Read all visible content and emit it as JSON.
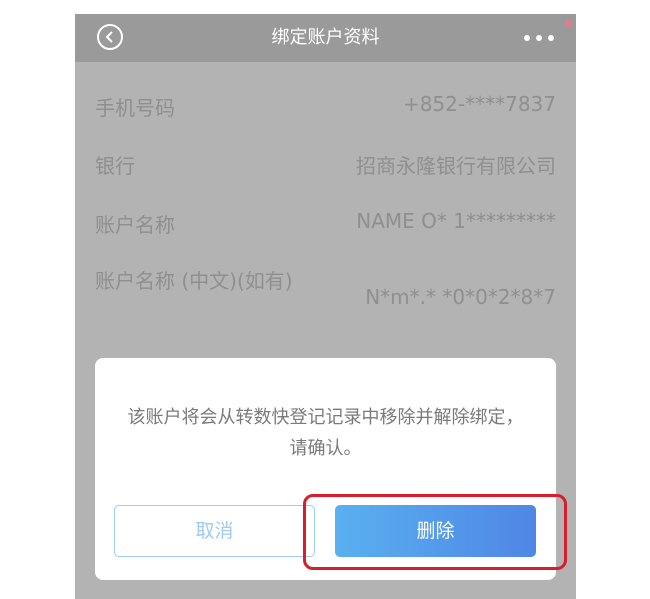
{
  "navbar": {
    "title": "绑定账户资料",
    "back_icon": "chevron-left-circle-icon",
    "more_icon": "more-dots-icon"
  },
  "details": [
    {
      "label": "手机号码",
      "value": "+852-****7837"
    },
    {
      "label": "银行",
      "value": "招商永隆银行有限公司"
    },
    {
      "label": "账户名称",
      "value": "NAME O* 1*********"
    },
    {
      "label": "账户名称 (中文)(如有)",
      "value": "N*m*.* *0*0*2*8*7"
    }
  ],
  "dialog": {
    "message": "该账户将会从转数快登记记录中移除并解除绑定，请确认。",
    "cancel_label": "取消",
    "delete_label": "删除"
  },
  "colors": {
    "overlay_bg": "#b3b3b3",
    "navbar_bg": "#9a9a9a",
    "delete_gradient_start": "#5ab0f0",
    "delete_gradient_end": "#4f86e6",
    "cancel_border": "#9fcbf2",
    "highlight": "#d81e2c",
    "notification_dot": "#e87a84"
  }
}
